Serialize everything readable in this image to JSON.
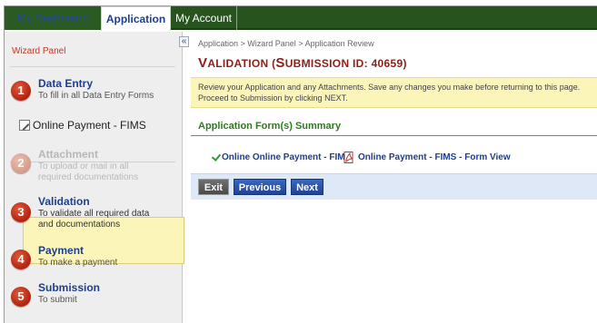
{
  "topnav": {
    "tabs": [
      {
        "label": "My Dashboard"
      },
      {
        "label": "Application"
      },
      {
        "label": "My Account"
      }
    ]
  },
  "sidebar": {
    "title": "Wizard Panel",
    "steps": [
      {
        "num": "1",
        "title": "Data Entry",
        "sub": "To fill in all Data Entry Forms"
      },
      {
        "num": "2",
        "title": "Attachment",
        "sub": "To upload or mail in all required documentations"
      },
      {
        "num": "3",
        "title": "Validation",
        "sub": "To validate all required data and documentations"
      },
      {
        "num": "4",
        "title": "Payment",
        "sub": "To make a payment"
      },
      {
        "num": "5",
        "title": "Submission",
        "sub": "To submit"
      }
    ],
    "subitem": "Online Payment - FIMS"
  },
  "collapse_glyph": "«",
  "main": {
    "breadcrumb": "Application > Wizard Panel > Application Review",
    "heading_big_v": "V",
    "heading_rest1": "ALIDATION (",
    "heading_big_s": "S",
    "heading_rest2": "UBMISSION ID: 40659)",
    "notice": "Review your Application and any Attachments. Save any changes you make before returning to this page. Proceed to Submission by clicking NEXT.",
    "section_title": "Application Form(s) Summary",
    "link1": "Online Online Payment - FIMS",
    "link2": "Online Payment - FIMS - Form View",
    "buttons": {
      "exit": "Exit",
      "previous": "Previous",
      "next": "Next"
    }
  },
  "colors": {
    "nav": "#27531f",
    "heading": "#8e1f16",
    "highlight": "#fbf5b9",
    "link": "#1d3f8c",
    "section": "#2f7a21"
  }
}
